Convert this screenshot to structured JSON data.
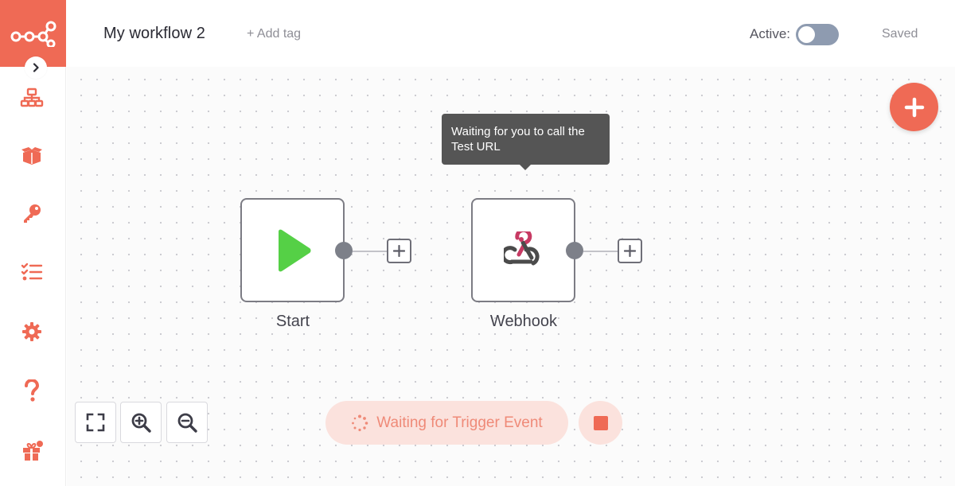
{
  "header": {
    "workflow_name": "My workflow 2",
    "add_tag": "+ Add tag",
    "active_label": "Active:",
    "active": false,
    "status": "Saved"
  },
  "sidebar": {
    "items": [
      {
        "icon": "network-icon",
        "label": "Workflows"
      },
      {
        "icon": "box-open-icon",
        "label": "Templates"
      },
      {
        "icon": "key-icon",
        "label": "Credentials"
      },
      {
        "icon": "tasks-icon",
        "label": "Executions"
      },
      {
        "icon": "cog-icon",
        "label": "Settings"
      },
      {
        "icon": "question-icon",
        "label": "Help"
      },
      {
        "icon": "gift-icon",
        "label": "What's New"
      }
    ]
  },
  "canvas": {
    "tooltip": "Waiting for you to call the Test URL",
    "nodes": [
      {
        "name": "Start",
        "icon": "play-icon"
      },
      {
        "name": "Webhook",
        "icon": "webhook-icon"
      }
    ]
  },
  "footer": {
    "waiting_text": "Waiting for Trigger Event"
  },
  "colors": {
    "brand": "#ef6a55",
    "start_green": "#55d046",
    "webhook_red": "#c73a63",
    "webhook_dark": "#4b4b4b"
  }
}
